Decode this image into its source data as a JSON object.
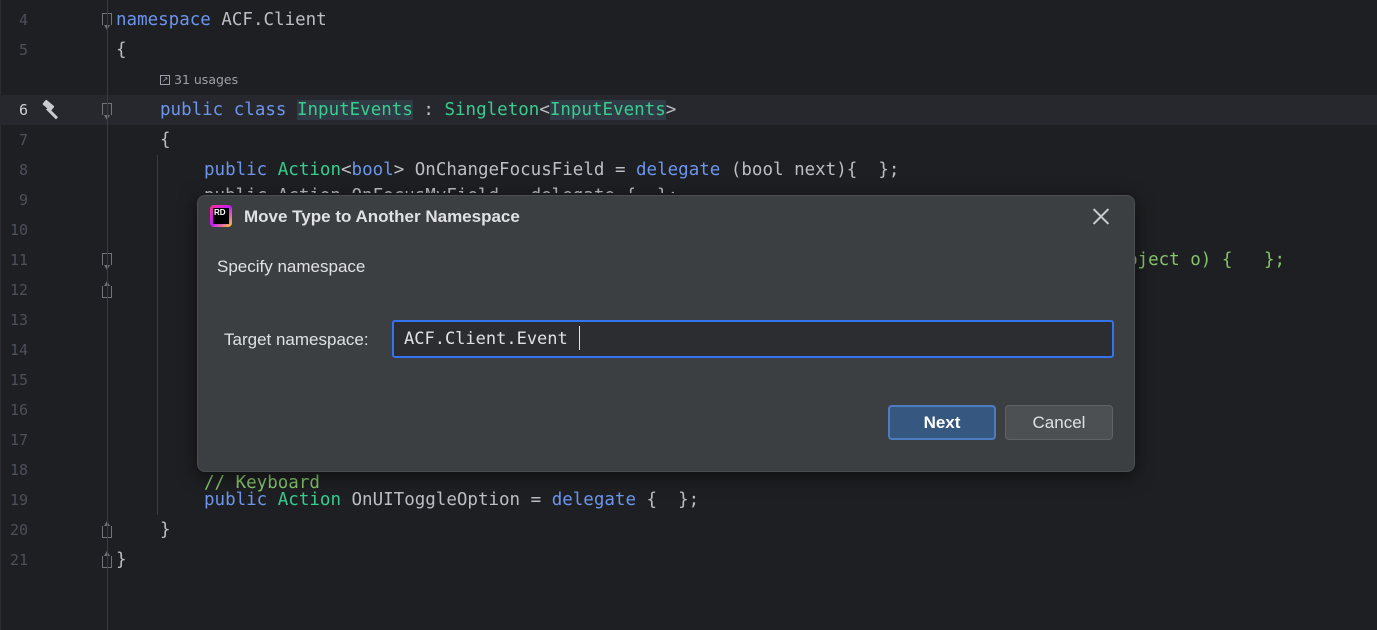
{
  "editor": {
    "usages_label": "31 usages",
    "line_numbers": [
      "4",
      "5",
      "6",
      "7",
      "8",
      "9",
      "10",
      "11",
      "12",
      "13",
      "14",
      "15",
      "16",
      "17",
      "18",
      "19",
      "20",
      "21"
    ],
    "active_line": "6",
    "code": {
      "l4_kw": "namespace",
      "l4_name": " ACF.Client",
      "l5": "{",
      "l6_kw": "public class ",
      "l6_class": "InputEvents",
      "l6_colon": " : ",
      "l6_base": "Singleton",
      "l6_lt": "<",
      "l6_gen": "InputEvents",
      "l6_gt": ">",
      "l7": "{",
      "l8_kw": "public ",
      "l8_type": "Action",
      "l8_lt": "<",
      "l8_bool": "bool",
      "l8_rest": "> OnChangeFocusField = ",
      "l8_delegate": "delegate",
      "l8_args": " (bool next){  };",
      "l9_partial": "public Action OnFocusMyField = delegate {  };",
      "l11_partial": "bject o) {   };",
      "l18_comment": "// Keyboard",
      "l19_kw": "public ",
      "l19_type": "Action",
      "l19_rest": " OnUIToggleOption = ",
      "l19_delegate": "delegate",
      "l19_end": " {  };",
      "l20": "}",
      "l21": "}"
    }
  },
  "dialog": {
    "title": "Move Type to Another Namespace",
    "app_icon_text": "RD",
    "subtitle": "Specify namespace",
    "field_label": "Target namespace:",
    "field_value": "ACF.Client.Event",
    "next_label": "Next",
    "cancel_label": "Cancel"
  }
}
